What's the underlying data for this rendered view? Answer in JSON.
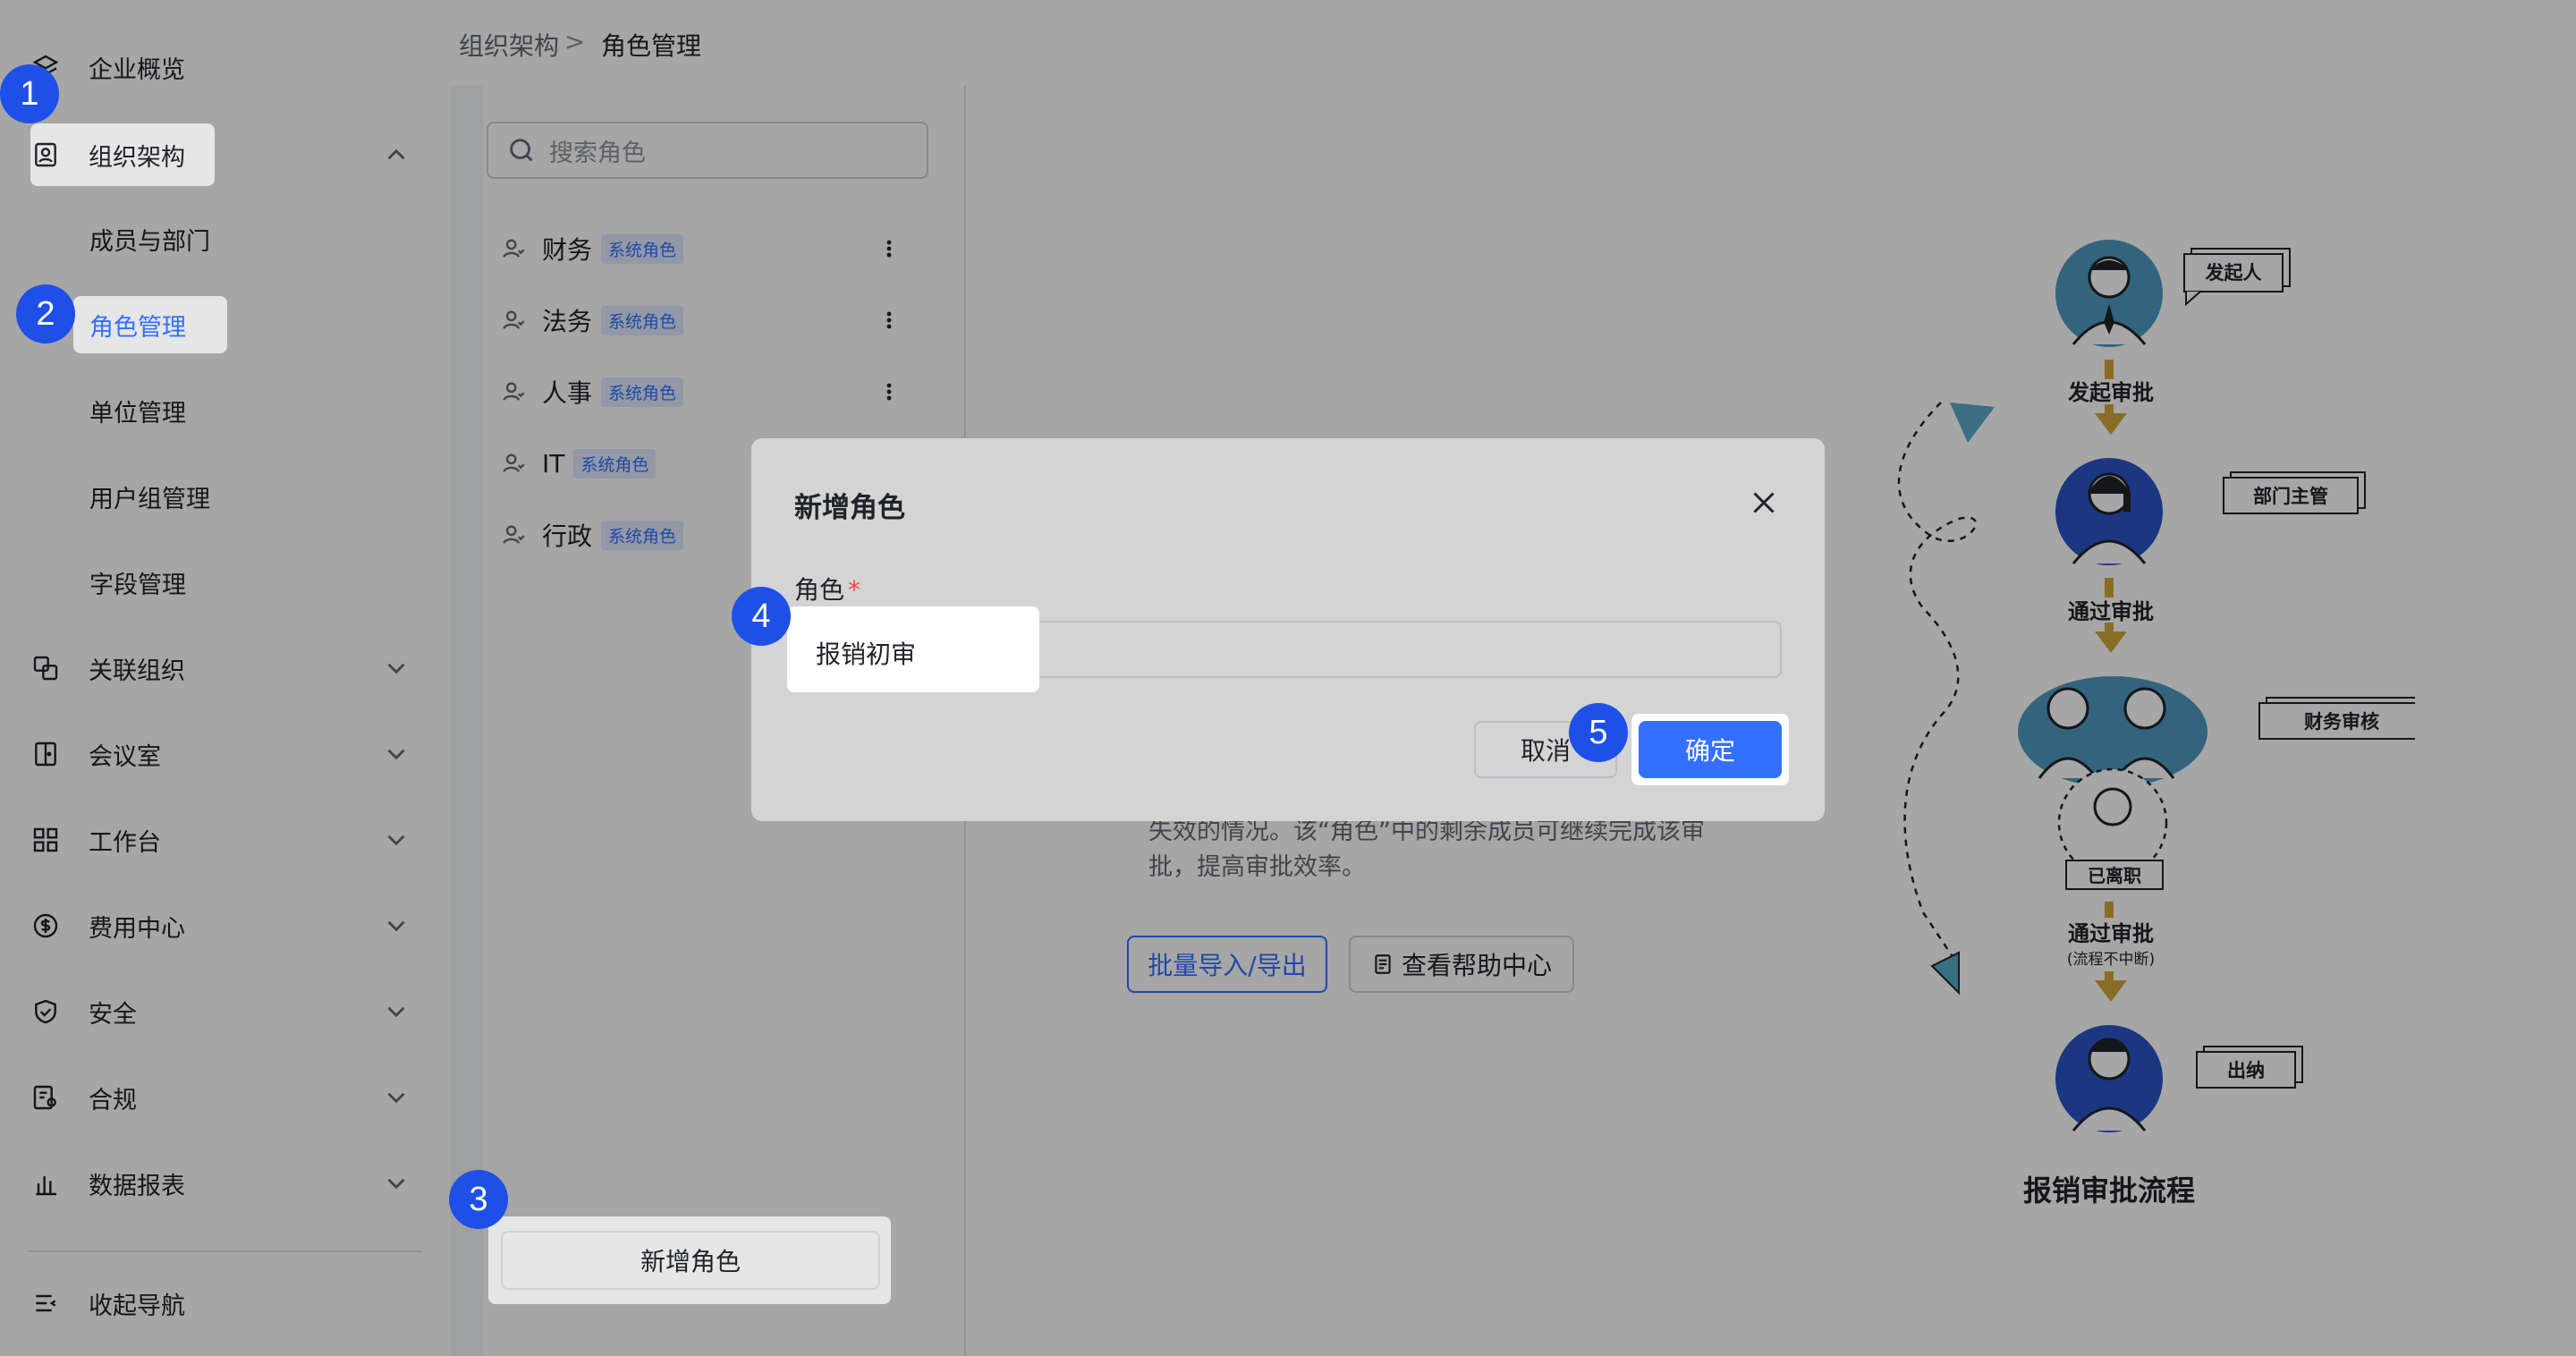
{
  "breadcrumb": {
    "parent": "组织架构",
    "separator": ">",
    "current": "角色管理"
  },
  "sidebar": {
    "items": [
      {
        "label": "企业概览",
        "icon": "layers-icon"
      },
      {
        "label": "组织架构",
        "icon": "org-card-icon",
        "expanded": true
      },
      {
        "label": "关联组织",
        "icon": "linked-org-icon"
      },
      {
        "label": "会议室",
        "icon": "meeting-room-icon"
      },
      {
        "label": "工作台",
        "icon": "grid-apps-icon"
      },
      {
        "label": "费用中心",
        "icon": "dollar-circle-icon"
      },
      {
        "label": "安全",
        "icon": "shield-icon"
      },
      {
        "label": "合规",
        "icon": "compliance-icon"
      },
      {
        "label": "数据报表",
        "icon": "bar-chart-icon"
      }
    ],
    "sub_items": [
      "成员与部门",
      "角色管理",
      "单位管理",
      "用户组管理",
      "字段管理"
    ],
    "collapse_label": "收起导航"
  },
  "roles": {
    "search_placeholder": "搜索角色",
    "system_badge": "系统角色",
    "list": [
      "财务",
      "法务",
      "人事",
      "IT",
      "行政"
    ],
    "add_label": "新增角色"
  },
  "main": {
    "desc_line1": "失效的情况。该“角色”中的剩余成员可继续完成该审",
    "desc_line2": "批，提高审批效率。",
    "import_export": "批量导入/导出",
    "help_center": "查看帮助中心",
    "illustration": {
      "title": "报销审批流程",
      "initiator": "发起人",
      "step1": "发起审批",
      "dept_manager": "部门主管",
      "step2": "通过审批",
      "finance_review": "财务审核",
      "resigned": "已离职",
      "step3": "通过审批",
      "step3_note": "(流程不中断)",
      "cashier": "出纳"
    }
  },
  "modal": {
    "title": "新增角色",
    "field_label": "角色",
    "required_mark": "*",
    "field_value": "报销初审",
    "cancel": "取消",
    "confirm": "确定"
  },
  "steps": [
    "1",
    "2",
    "3",
    "4",
    "5"
  ],
  "colors": {
    "accent": "#3370ff",
    "step_badge": "#1e50e8",
    "danger": "#f54a45"
  }
}
